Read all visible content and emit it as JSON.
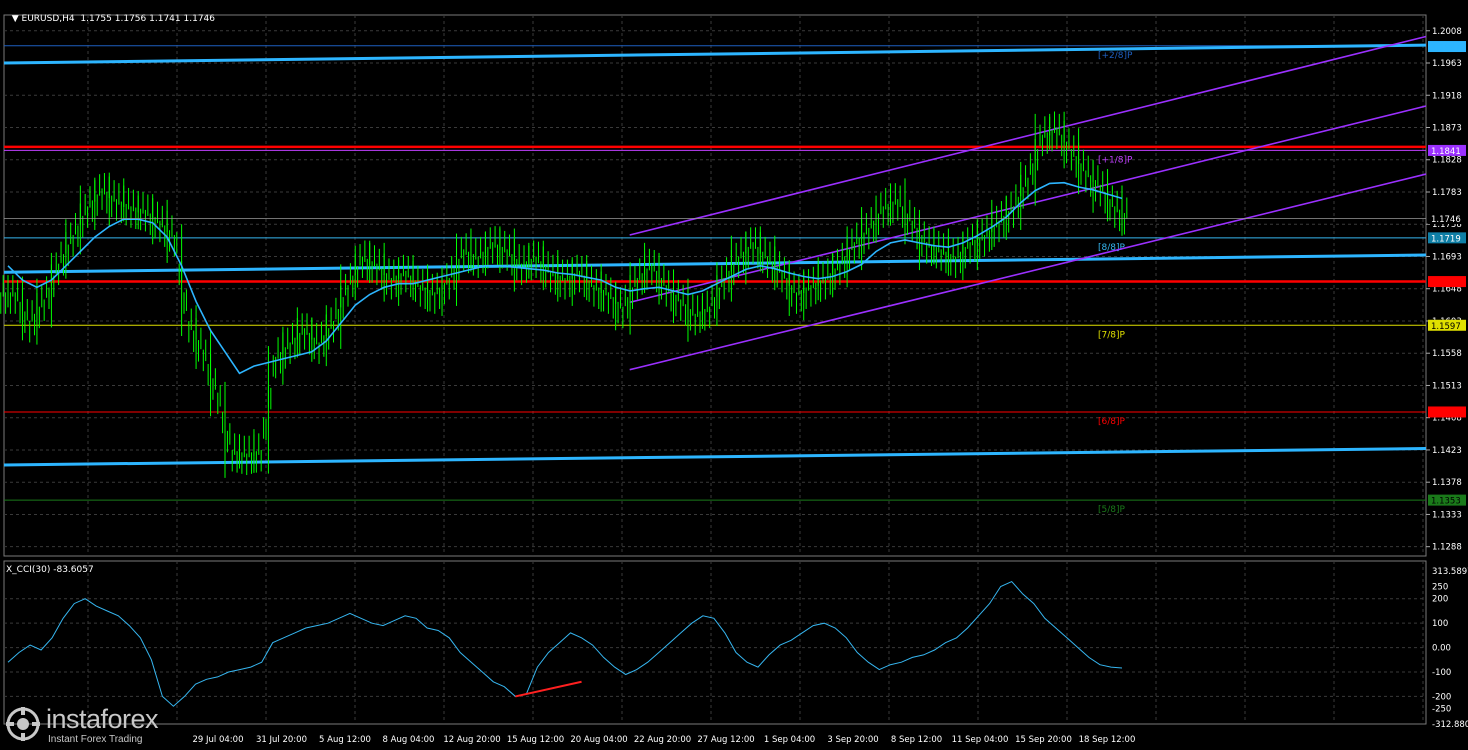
{
  "header": {
    "symbol_text": "EURUSD,H4",
    "open": "1.1755",
    "high": "1.1756",
    "low": "1.1741",
    "close": "1.1746"
  },
  "cci_header": "X_CCI(30) -83.6057",
  "logo": {
    "name": "instaforex",
    "tagline": "Instant Forex Trading"
  },
  "colors": {
    "background": "#000000",
    "grid": "#3a3a3a",
    "candles": "#00ff00",
    "ma": "#2db5ff",
    "trend_line": "#2db5ff",
    "channel": "#9b30ff",
    "level_red": "#ff0000",
    "cci_line": "#36b6f0",
    "divergence": "#ff2020"
  },
  "chart_data": [
    {
      "type": "line",
      "title": "EURUSD,H4",
      "ylim": [
        1.1275,
        1.203
      ],
      "y_ticks": [
        "1.2008",
        "1.1963",
        "1.1918",
        "1.1873",
        "1.1828",
        "1.1783",
        "1.1738",
        "1.1693",
        "1.1648",
        "1.1603",
        "1.1558",
        "1.1513",
        "1.1468",
        "1.1423",
        "1.1378",
        "1.1333",
        "1.1288"
      ],
      "x_tick_labels": [
        "29 Jul 04:00",
        "31 Jul 20:00",
        "5 Aug 12:00",
        "8 Aug 04:00",
        "12 Aug 20:00",
        "15 Aug 12:00",
        "20 Aug 04:00",
        "22 Aug 20:00",
        "27 Aug 12:00",
        "1 Sep 04:00",
        "3 Sep 20:00",
        "8 Sep 12:00",
        "11 Sep 04:00",
        "15 Sep 20:00",
        "18 Sep 12:00"
      ],
      "price_markers": [
        {
          "value": 1.1986,
          "label": "1.1987",
          "bg": "#2db5ff",
          "fg": "#2db5ff"
        },
        {
          "value": 1.1841,
          "label": "1.1841",
          "bg": "#9b30ff",
          "fg": "#ffffff"
        },
        {
          "value": 1.1746,
          "label": "1.1746",
          "bg": "#000000",
          "fg": "#ffffff"
        },
        {
          "value": 1.1719,
          "label": "1.1719",
          "bg": "#0f7fa6",
          "fg": "#ffffff"
        },
        {
          "value": 1.1658,
          "label": "1.1658",
          "bg": "#ff0000",
          "fg": "#ff0000"
        },
        {
          "value": 1.1597,
          "label": "1.1597",
          "bg": "#e0e000",
          "fg": "#000000"
        },
        {
          "value": 1.1476,
          "label": "1.1476",
          "bg": "#ff0000",
          "fg": "#ff0000"
        },
        {
          "value": 1.1353,
          "label": "1.1353",
          "bg": "#1a7a1a",
          "fg": "#000000"
        }
      ],
      "murrey_levels": [
        {
          "value": 1.1987,
          "label": "[+2/8]P",
          "color": "#1e5fbf"
        },
        {
          "value": 1.1841,
          "label": "[+1/8]P",
          "color": "#c040ff"
        },
        {
          "value": 1.1719,
          "label": "[8/8]P",
          "color": "#36b6f0"
        },
        {
          "value": 1.1597,
          "label": "[7/8]P",
          "color": "#e0e000"
        },
        {
          "value": 1.1476,
          "label": "[6/8]P",
          "color": "#ff0000"
        },
        {
          "value": 1.1353,
          "label": "[5/8]P",
          "color": "#1a7a1a"
        }
      ],
      "close_series": [
        1.164,
        1.16,
        1.163,
        1.168,
        1.172,
        1.176,
        1.1785,
        1.177,
        1.176,
        1.1755,
        1.174,
        1.172,
        1.16,
        1.156,
        1.15,
        1.142,
        1.1415,
        1.142,
        1.155,
        1.157,
        1.159,
        1.157,
        1.16,
        1.165,
        1.169,
        1.168,
        1.166,
        1.167,
        1.165,
        1.164,
        1.166,
        1.17,
        1.169,
        1.171,
        1.17,
        1.168,
        1.169,
        1.167,
        1.166,
        1.167,
        1.165,
        1.164,
        1.162,
        1.166,
        1.168,
        1.165,
        1.163,
        1.161,
        1.162,
        1.166,
        1.169,
        1.171,
        1.169,
        1.167,
        1.164,
        1.165,
        1.166,
        1.168,
        1.171,
        1.173,
        1.176,
        1.177,
        1.174,
        1.171,
        1.17,
        1.169,
        1.171,
        1.172,
        1.174,
        1.176,
        1.18,
        1.186,
        1.187,
        1.184,
        1.181,
        1.179,
        1.176,
        1.1746
      ],
      "ma_series": [
        1.168,
        1.166,
        1.165,
        1.166,
        1.168,
        1.17,
        1.172,
        1.1735,
        1.1745,
        1.1745,
        1.174,
        1.172,
        1.168,
        1.163,
        1.159,
        1.156,
        1.153,
        1.154,
        1.1545,
        1.155,
        1.1555,
        1.156,
        1.1575,
        1.16,
        1.1625,
        1.164,
        1.165,
        1.1655,
        1.1655,
        1.166,
        1.1665,
        1.167,
        1.1675,
        1.168,
        1.168,
        1.1678,
        1.1676,
        1.1674,
        1.167,
        1.1668,
        1.1664,
        1.166,
        1.165,
        1.1645,
        1.1648,
        1.165,
        1.1645,
        1.164,
        1.1645,
        1.1655,
        1.1665,
        1.1675,
        1.168,
        1.1676,
        1.167,
        1.1665,
        1.1662,
        1.1665,
        1.1672,
        1.1682,
        1.17,
        1.1712,
        1.1716,
        1.1712,
        1.1708,
        1.1706,
        1.1712,
        1.1722,
        1.1734,
        1.1748,
        1.1768,
        1.1785,
        1.1795,
        1.1796,
        1.179,
        1.1786,
        1.178,
        1.1774
      ],
      "trend_lines": [
        {
          "name": "upper",
          "x": [
            0,
            1
          ],
          "y": [
            1.1963,
            1.1988
          ]
        },
        {
          "name": "lower",
          "x": [
            0,
            1
          ],
          "y": [
            1.1402,
            1.1425
          ]
        },
        {
          "name": "middle",
          "x": [
            0,
            1
          ],
          "y": [
            1.1671,
            1.1695
          ]
        }
      ],
      "channel_lines": [
        {
          "name": "channel-top",
          "x": [
            0.44,
            1
          ],
          "y": [
            1.1723,
            1.2
          ]
        },
        {
          "name": "channel-mid",
          "x": [
            0.44,
            1
          ],
          "y": [
            1.1629,
            1.1903
          ]
        },
        {
          "name": "channel-bottom",
          "x": [
            0.44,
            1
          ],
          "y": [
            1.1535,
            1.1808
          ]
        }
      ],
      "red_levels": [
        1.1846,
        1.1658
      ]
    },
    {
      "type": "line",
      "title": "X_CCI(30) -83.6057",
      "ylim": [
        -312.88,
        313.5897
      ],
      "y_ticks": [
        "313.5897",
        "250",
        "200",
        "100",
        "0.00",
        "-100",
        "-200",
        "-250",
        "-312.8800"
      ],
      "values": [
        -60,
        -20,
        10,
        -10,
        40,
        120,
        180,
        200,
        170,
        150,
        130,
        90,
        40,
        -50,
        -200,
        -240,
        -200,
        -150,
        -130,
        -120,
        -100,
        -90,
        -80,
        -60,
        20,
        40,
        60,
        80,
        90,
        100,
        120,
        140,
        120,
        100,
        90,
        110,
        130,
        120,
        80,
        70,
        40,
        -20,
        -60,
        -100,
        -140,
        -160,
        -200,
        -190,
        -80,
        -20,
        20,
        60,
        40,
        10,
        -40,
        -80,
        -110,
        -90,
        -60,
        -20,
        20,
        60,
        100,
        130,
        120,
        60,
        -20,
        -60,
        -80,
        -30,
        10,
        30,
        60,
        90,
        100,
        80,
        40,
        -20,
        -60,
        -90,
        -70,
        -60,
        -40,
        -30,
        -10,
        20,
        40,
        80,
        130,
        180,
        250,
        270,
        220,
        180,
        120,
        80,
        40,
        0,
        -40,
        -70,
        -80,
        -83.6
      ],
      "divergence": {
        "from_index": 46,
        "to_index": 52,
        "from_value": -200,
        "to_value": -140
      }
    }
  ]
}
